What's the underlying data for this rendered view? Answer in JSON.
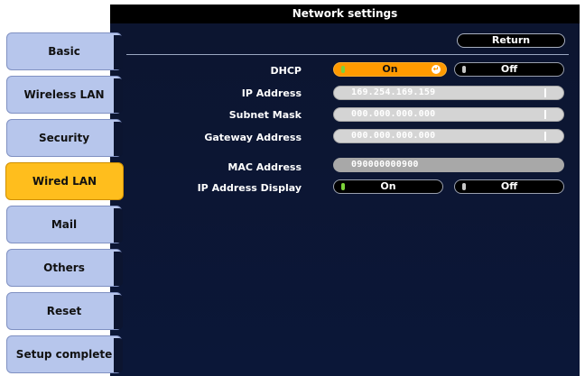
{
  "window": {
    "title": "Network settings"
  },
  "sidebar": {
    "items": [
      {
        "label": "Basic"
      },
      {
        "label": "Wireless LAN"
      },
      {
        "label": "Security"
      },
      {
        "label": "Wired LAN",
        "active": true
      },
      {
        "label": "Mail"
      },
      {
        "label": "Others"
      },
      {
        "label": "Reset"
      },
      {
        "label": "Setup complete"
      }
    ]
  },
  "header": {
    "return_label": "Return"
  },
  "settings": {
    "dhcp": {
      "label": "DHCP",
      "on_label": "On",
      "off_label": "Off",
      "selected": "On"
    },
    "ip_address": {
      "label": "IP Address",
      "value": "169.254.169.159"
    },
    "subnet_mask": {
      "label": "Subnet Mask",
      "value": "000.000.000.000"
    },
    "gateway_address": {
      "label": "Gateway Address",
      "value": "000.000.000.000"
    },
    "mac_address": {
      "label": "MAC Address",
      "value": "090000000900"
    },
    "ip_address_display": {
      "label": "IP Address Display",
      "on_label": "On",
      "off_label": "Off",
      "selected": "On"
    }
  },
  "colors": {
    "accent": "#ff9a00",
    "active_tab": "#ffbe1d",
    "tab": "#b7c6ec",
    "panel": "#0c1530",
    "led_on": "#7cd33a"
  },
  "icons": {
    "enter": "enter-icon",
    "indicator_on": "led-on-icon",
    "indicator_off": "led-off-icon"
  }
}
